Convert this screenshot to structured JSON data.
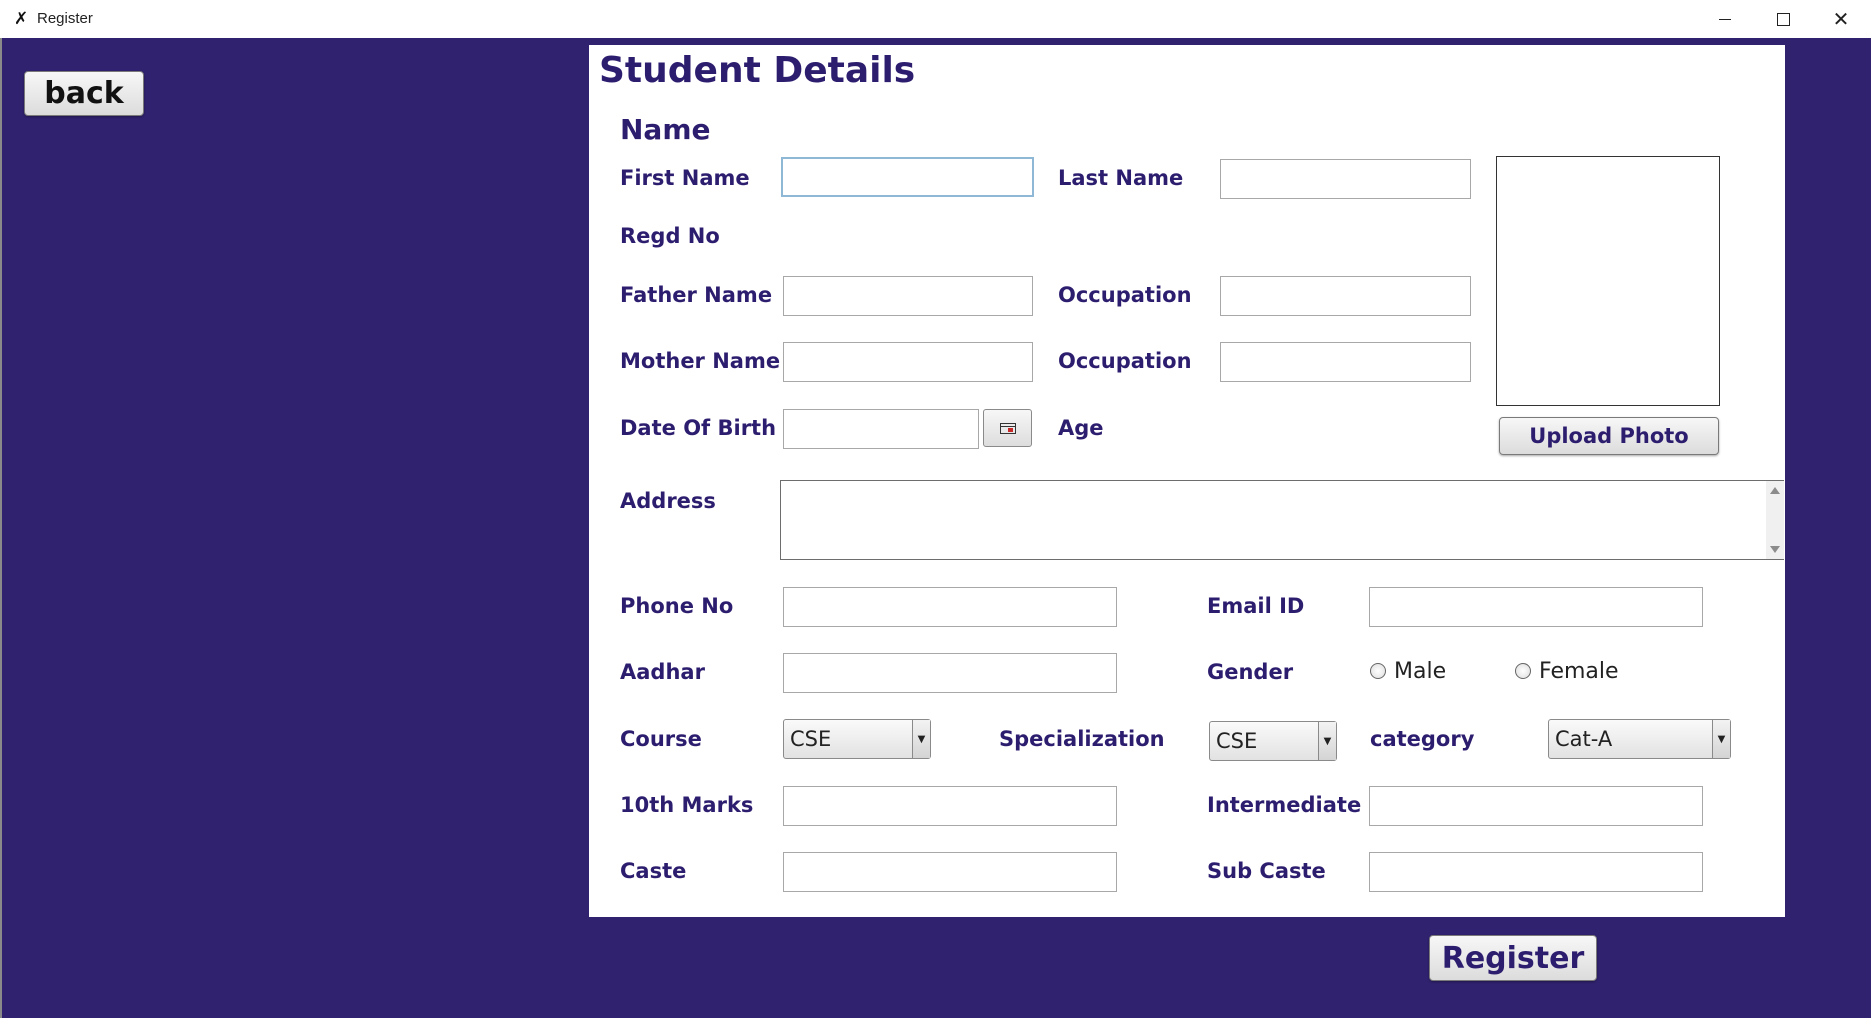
{
  "window": {
    "title": "Register",
    "app_icon": "java-duke-icon",
    "controls": {
      "minimize": "minimize-icon",
      "maximize": "maximize-icon",
      "close": "close-icon"
    }
  },
  "colors": {
    "background": "#312270",
    "label": "#2d1d6e",
    "panel": "#ffffff"
  },
  "back_button": "back",
  "form": {
    "heading": "Student Details",
    "name_section": "Name",
    "first_name_label": "First Name",
    "first_name_value": "",
    "last_name_label": "Last Name",
    "last_name_value": "",
    "regd_no_label": "Regd No",
    "father_name_label": "Father Name",
    "father_name_value": "",
    "father_occupation_label": "Occupation",
    "father_occupation_value": "",
    "mother_name_label": "Mother Name",
    "mother_name_value": "",
    "mother_occupation_label": "Occupation",
    "mother_occupation_value": "",
    "dob_label": "Date Of Birth",
    "dob_value": "",
    "calendar_icon": "calendar-icon",
    "age_label": "Age",
    "upload_photo_label": "Upload Photo",
    "address_label": "Address",
    "address_value": "",
    "phone_label": "Phone No",
    "phone_value": "",
    "email_label": "Email ID",
    "email_value": "",
    "aadhar_label": "Aadhar",
    "aadhar_value": "",
    "gender_label": "Gender",
    "gender_options": [
      "Male",
      "Female"
    ],
    "course_label": "Course",
    "course_selected": "CSE",
    "specialization_label": "Specialization",
    "specialization_selected": "CSE",
    "category_label": "category",
    "category_selected": "Cat-A",
    "tenth_marks_label": "10th Marks",
    "tenth_marks_value": "",
    "intermediate_label": "Intermediate",
    "intermediate_value": "",
    "caste_label": "Caste",
    "caste_value": "",
    "sub_caste_label": "Sub Caste",
    "sub_caste_value": ""
  },
  "register_button": "Register"
}
